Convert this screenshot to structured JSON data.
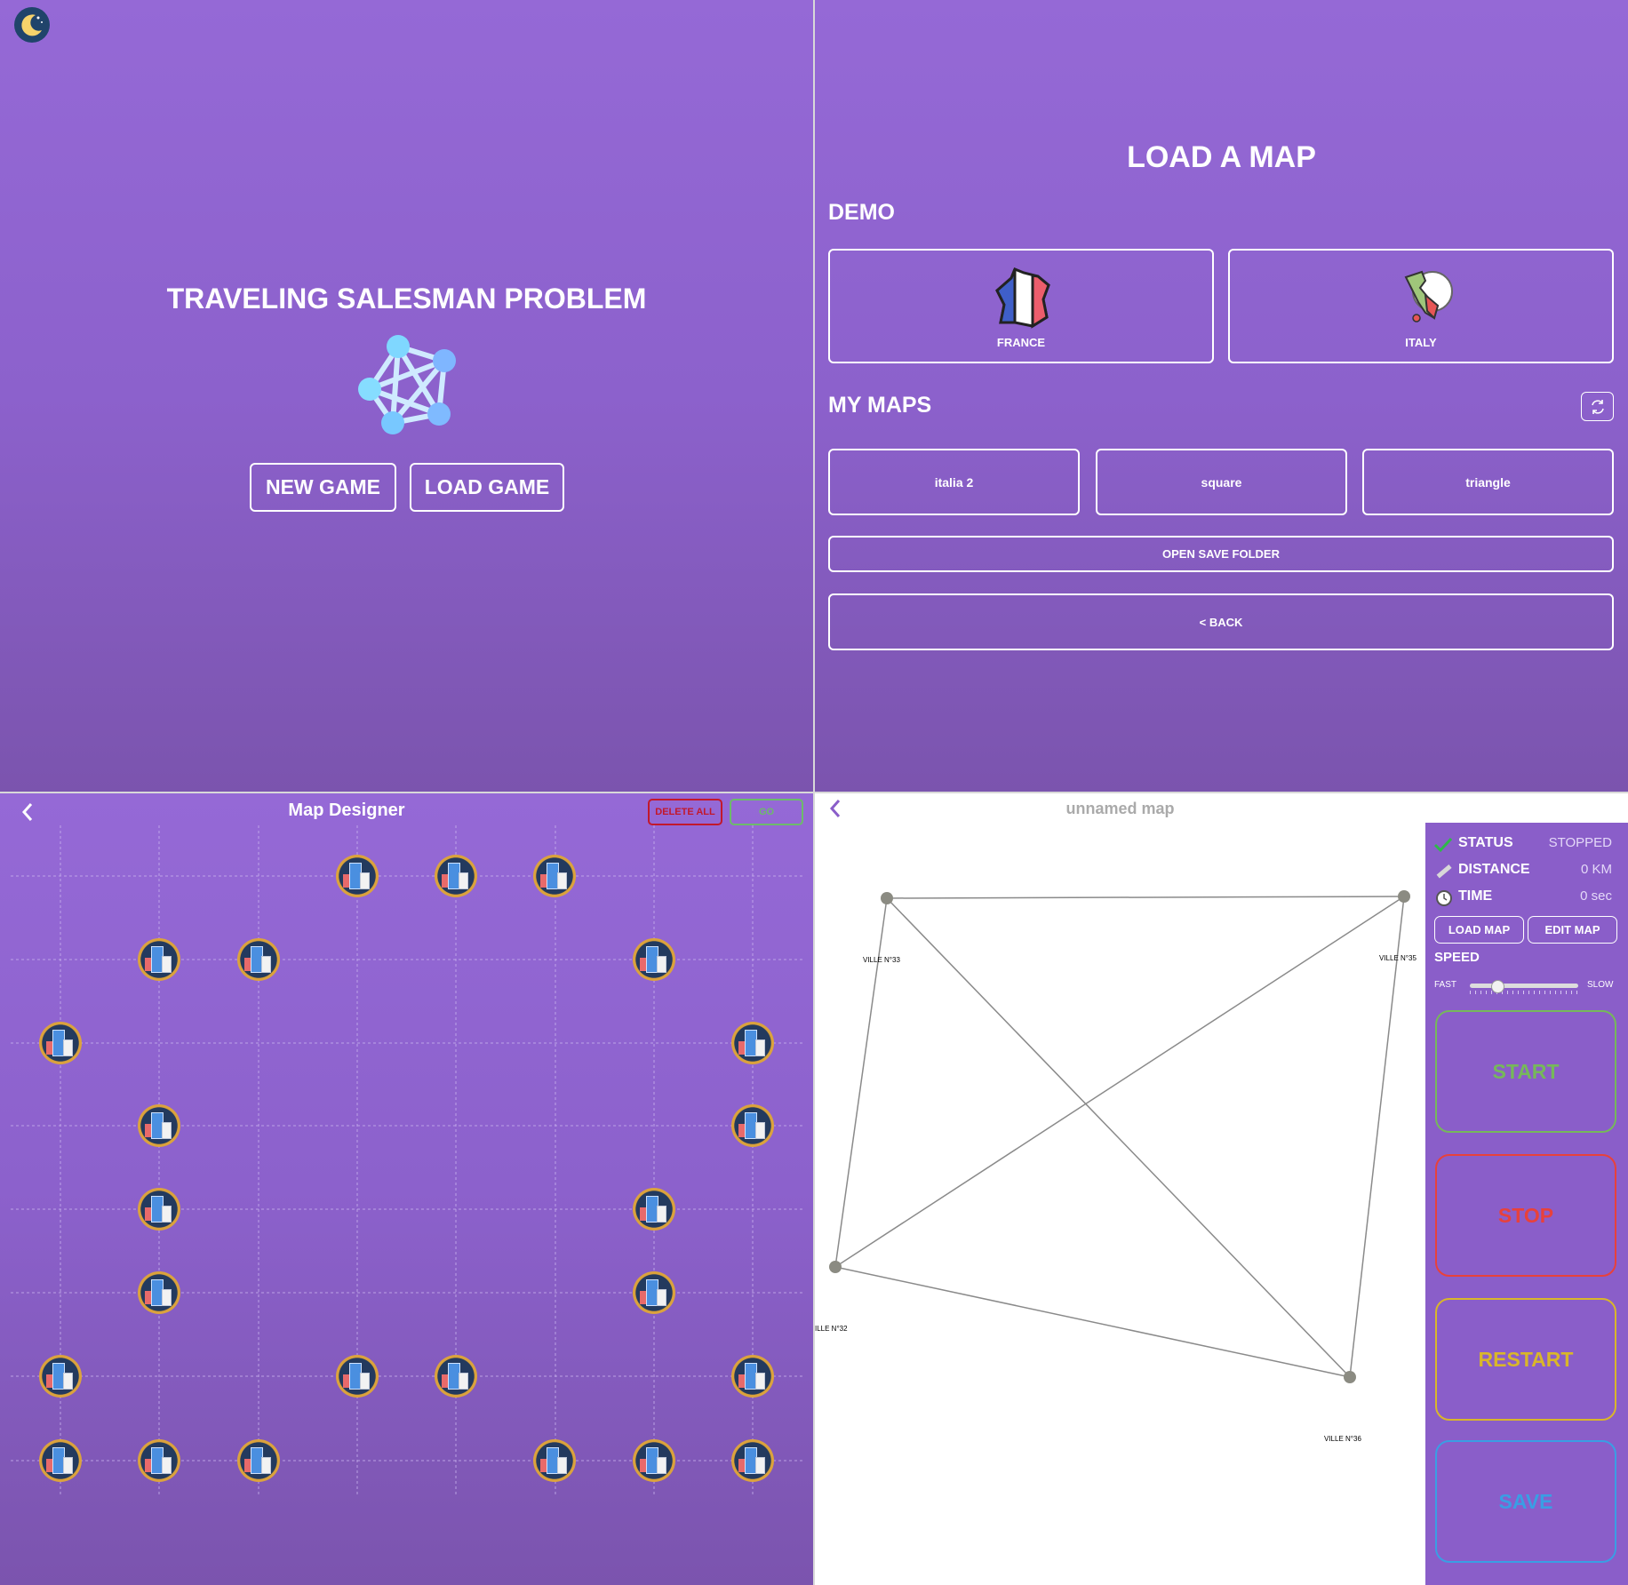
{
  "home": {
    "title": "TRAVELING SALESMAN PROBLEM",
    "new_game": "NEW GAME",
    "load_game": "LOAD GAME"
  },
  "load_map": {
    "title": "LOAD A MAP",
    "demo_heading": "DEMO",
    "demo_maps": [
      "FRANCE",
      "ITALY"
    ],
    "my_maps_heading": "MY MAPS",
    "my_maps": [
      "italia 2",
      "square",
      "triangle"
    ],
    "open_save_folder": "OPEN SAVE FOLDER",
    "back": "< BACK"
  },
  "designer": {
    "title": "Map Designer",
    "delete_all": "DELETE ALL",
    "go": "GO"
  },
  "solver": {
    "map_name": "unnamed map",
    "status_label": "STATUS",
    "status_value": "STOPPED",
    "distance_label": "DISTANCE",
    "distance_value": "0 KM",
    "time_label": "TIME",
    "time_value": "0 sec",
    "load_map": "LOAD MAP",
    "edit_map": "EDIT MAP",
    "speed_label": "SPEED",
    "speed_fast": "FAST",
    "speed_slow": "SLOW",
    "start": "START",
    "stop": "STOP",
    "restart": "RESTART",
    "save": "SAVE",
    "cities": [
      "VILLE N°33",
      "VILLE N°35",
      "ILLE N°32",
      "VILLE N°36"
    ]
  },
  "colors": {
    "start": "#76b85a",
    "stop": "#e8413b",
    "restart": "#d9b62a",
    "save": "#3a9ee4",
    "delete_all": "#c2182c",
    "go": "#6dbb6a"
  }
}
